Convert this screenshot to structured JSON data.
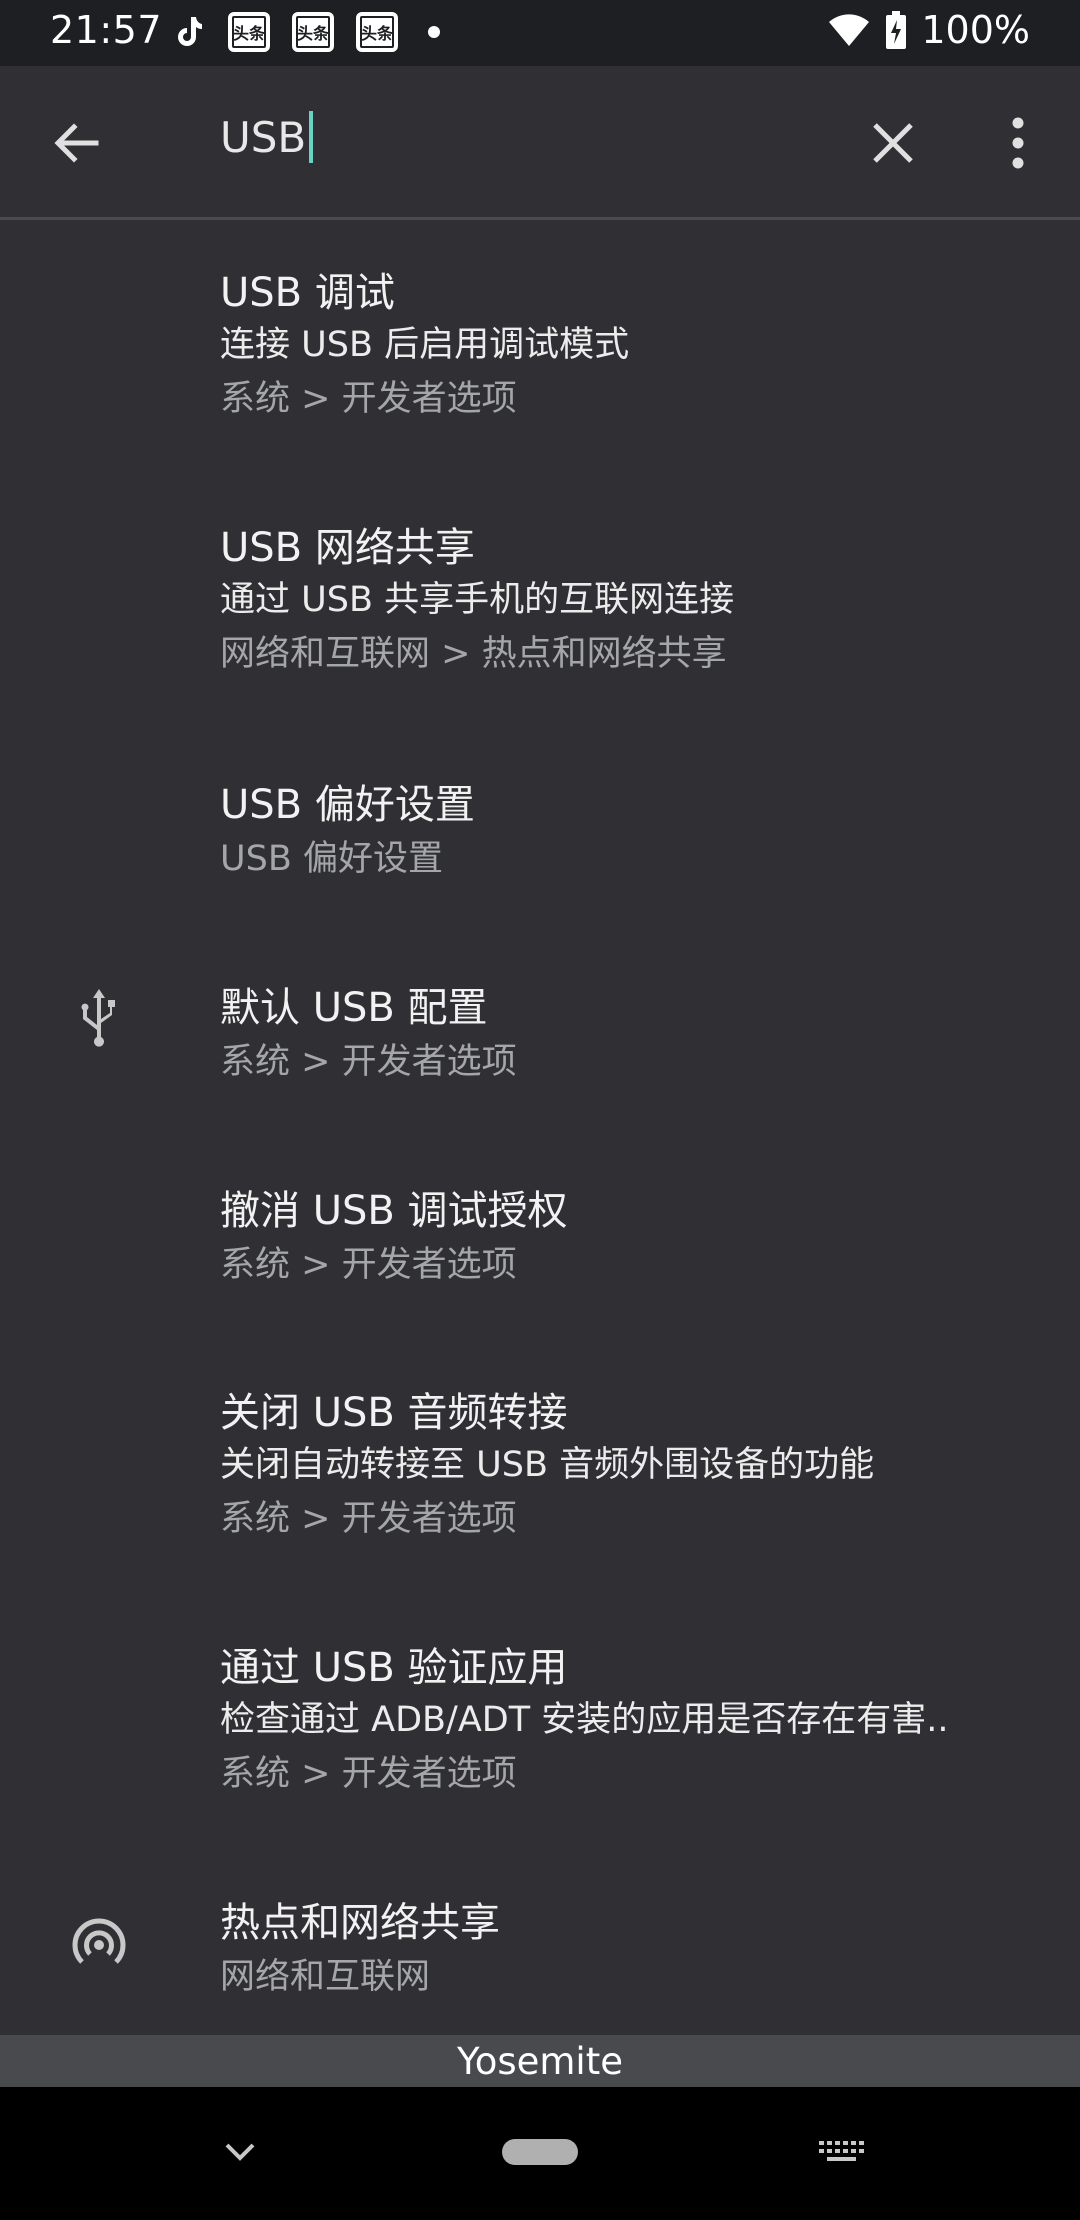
{
  "status_bar": {
    "time": "21:57",
    "app_icons": [
      "tiktok-icon",
      "toutiao-icon",
      "toutiao-icon",
      "toutiao-icon"
    ],
    "toutiao_label": "头条",
    "battery": "100%"
  },
  "search": {
    "query": "USB"
  },
  "results": [
    {
      "title": "USB 调试",
      "summary": "连接 USB 后启用调试模式",
      "path": "系统 > 开发者选项"
    },
    {
      "title": "USB 网络共享",
      "summary": "通过 USB 共享手机的互联网连接",
      "path": "网络和互联网 > 热点和网络共享"
    },
    {
      "title": "USB 偏好设置",
      "summary": "",
      "path": "USB 偏好设置"
    },
    {
      "title": "默认 USB 配置",
      "summary": "",
      "path": "系统 > 开发者选项",
      "icon": "usb-icon"
    },
    {
      "title": "撤消 USB 调试授权",
      "summary": "",
      "path": "系统 > 开发者选项"
    },
    {
      "title": "关闭 USB 音频转接",
      "summary": "关闭自动转接至 USB 音频外围设备的功能",
      "path": "系统 > 开发者选项"
    },
    {
      "title": "通过 USB 验证应用",
      "summary": "检查通过 ADB/ADT 安装的应用是否存在有害..",
      "path": "系统 > 开发者选项"
    },
    {
      "title": "热点和网络共享",
      "summary": "",
      "path": "网络和互联网",
      "icon": "hotspot-icon"
    }
  ],
  "keyboard_bar": {
    "label": "Yosemite"
  },
  "colors": {
    "background": "#303034",
    "caret": "#6ad1c3",
    "secondary_text": "#a4a6aa"
  }
}
